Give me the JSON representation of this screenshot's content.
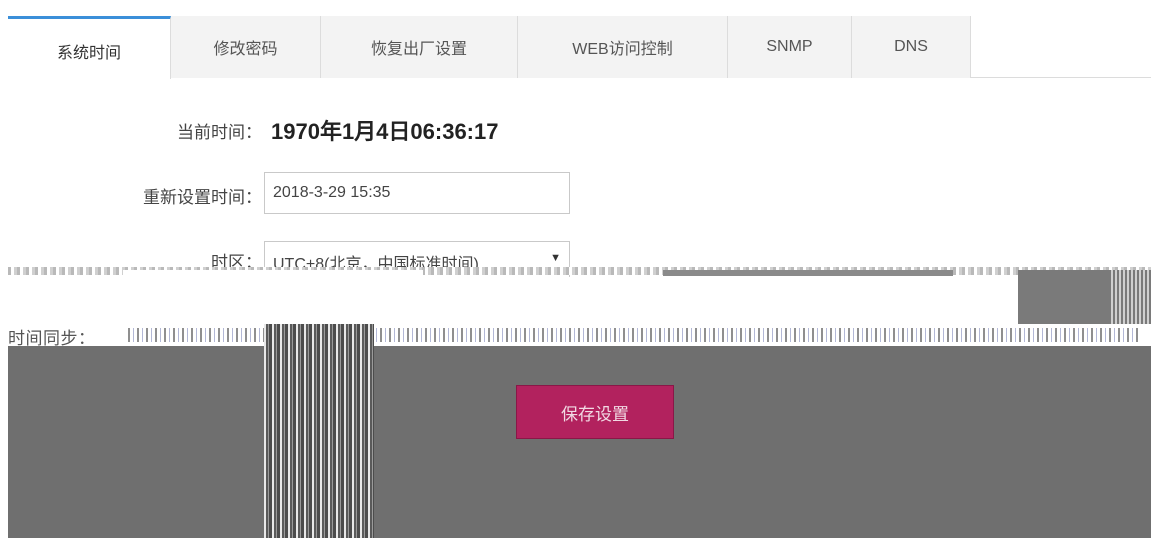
{
  "tabs": [
    {
      "label": "系统时间",
      "active": true
    },
    {
      "label": "修改密码",
      "active": false
    },
    {
      "label": "恢复出厂设置",
      "active": false
    },
    {
      "label": "WEB访问控制",
      "active": false
    },
    {
      "label": "SNMP",
      "active": false
    },
    {
      "label": "DNS",
      "active": false
    }
  ],
  "form": {
    "current_time_label": "当前时间：",
    "current_time_value": "1970年1月4日06:36:17",
    "reset_time_label": "重新设置时间：",
    "reset_time_value": "2018-3-29 15:35",
    "timezone_label": "时区：",
    "timezone_value": "UTC+8(北京，中国标准时间)",
    "sync_label": "时间同步："
  },
  "actions": {
    "save_label": "保存设置"
  },
  "colors": {
    "active_tab_accent": "#3b8fd9",
    "save_button": "#b2225e"
  }
}
